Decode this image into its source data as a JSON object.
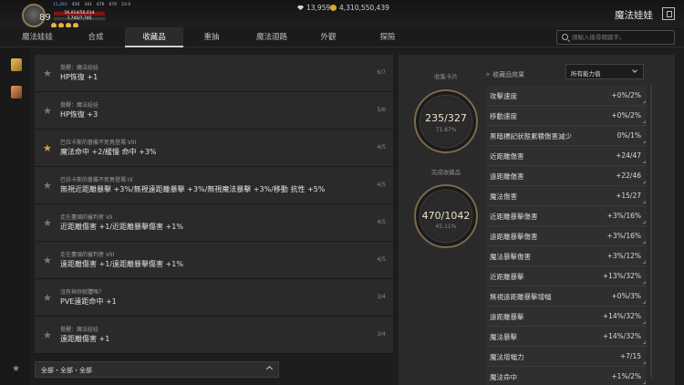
{
  "player": {
    "level": "89",
    "hp_text": "56,014/56,014",
    "mp_text": "7,745/7,745",
    "stats": [
      "11,283",
      "456",
      "341",
      "676",
      "670",
      "23 0"
    ]
  },
  "currency": {
    "diamonds": "13,959",
    "gold": "4,310,550,439"
  },
  "window_title": "魔法娃娃",
  "tabs": [
    "魔法娃娃",
    "合成",
    "收藏品",
    "重抽",
    "魔法迴路",
    "外觀",
    "探險"
  ],
  "active_tab": "收藏品",
  "search": {
    "placeholder": "請輸入搜尋關鍵字。"
  },
  "collection_list": [
    {
      "category": "覺醒：魔法娃娃",
      "effect": "HP恢復 +1",
      "count": "6/7",
      "favorite": false
    },
    {
      "category": "覺醒：魔法娃娃",
      "effect": "HP恢復 +3",
      "count": "5/6",
      "favorite": false
    },
    {
      "category": "巴拉卡斯的眷屬不死鳥登場 VIII",
      "effect": "魔法命中 +2/緩慢 命中 +3%",
      "count": "4/5",
      "favorite": true
    },
    {
      "category": "巴拉卡斯的眷屬不死鳥登場 IX",
      "effect": "無視近距離暴擊 +3%/無視遠距離暴擊 +3%/無視魔法暴擊 +3%/移動 抗性 +5%",
      "count": "4/5",
      "favorite": false
    },
    {
      "category": "走在盡頭的審判者 VII",
      "effect": "近距離傷害 +1/近距離暴擊傷害 +1%",
      "count": "4/5",
      "favorite": false
    },
    {
      "category": "走在盡頭的審判者 VIII",
      "effect": "遠距離傷害 +1/遠距離暴擊傷害 +1%",
      "count": "4/5",
      "favorite": false
    },
    {
      "category": "沒有與妳就體嗎？",
      "effect": "PVE遠距命中 +1",
      "count": "3/4",
      "favorite": false
    },
    {
      "category": "覺醒：魔法娃娃",
      "effect": "遠距離傷害 +1",
      "count": "3/4",
      "favorite": false
    }
  ],
  "filter": {
    "label": "全部・全部・全部"
  },
  "summary": {
    "cards_label": "收集卡片",
    "cards_value": "235/327",
    "cards_pct": "71.87%",
    "completed_label": "完成收藏品",
    "completed_value": "470/1042",
    "completed_pct": "45.11%"
  },
  "effects_header": "收藏品效果",
  "effects_dropdown": "所有能力值",
  "effects": [
    {
      "name": "攻擊速度",
      "value": "+0%/2%"
    },
    {
      "name": "移動速度",
      "value": "+0%/2%"
    },
    {
      "name": "黑暗標記狀態累積傷害減少",
      "value": "0%/1%"
    },
    {
      "name": "近距離傷害",
      "value": "+24/47"
    },
    {
      "name": "遠距離傷害",
      "value": "+22/46"
    },
    {
      "name": "魔法傷害",
      "value": "+15/27"
    },
    {
      "name": "近距離暴擊傷害",
      "value": "+3%/16%"
    },
    {
      "name": "遠距離暴擊傷害",
      "value": "+3%/16%"
    },
    {
      "name": "魔法暴擊傷害",
      "value": "+3%/12%"
    },
    {
      "name": "近距離暴擊",
      "value": "+13%/32%"
    },
    {
      "name": "無視遠距離暴擊增幅",
      "value": "+0%/3%"
    },
    {
      "name": "遠距離暴擊",
      "value": "+14%/32%"
    },
    {
      "name": "魔法暴擊",
      "value": "+14%/32%"
    },
    {
      "name": "魔法增幅力",
      "value": "+7/15"
    },
    {
      "name": "魔法命中",
      "value": "+1%/2%"
    }
  ]
}
